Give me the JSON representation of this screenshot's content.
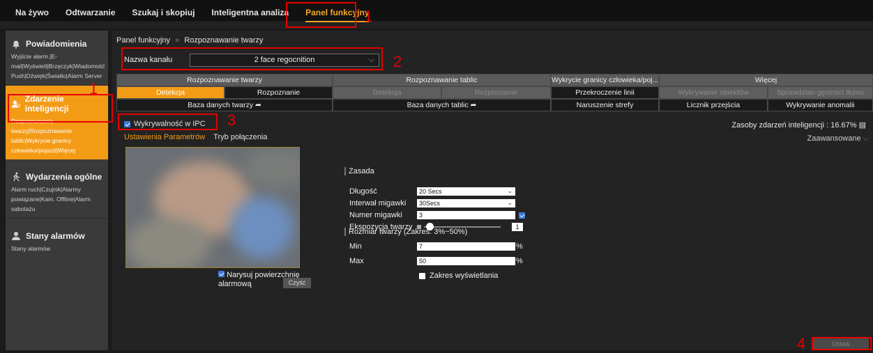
{
  "topnav": [
    {
      "label": "Na żywo",
      "active": false
    },
    {
      "label": "Odtwarzanie",
      "active": false
    },
    {
      "label": "Szukaj i skopiuj",
      "active": false
    },
    {
      "label": "Inteligentna analiza",
      "active": false
    },
    {
      "label": "Panel funkcyjny",
      "active": true
    }
  ],
  "sidebar": {
    "sections": [
      {
        "title": "Powiadomienia",
        "icon": "bell-icon",
        "links": "Wyjście alarm.|E-mail|Wyświetl|Brzęczyk|Wiadomość Push|Dźwięk|Światło|Alarm Server",
        "active": false
      },
      {
        "title": "Zdarzenie inteligencji",
        "icon": "face-scan-icon",
        "links": "Rozpoznawanie twarzy|Rozpoznawanie tablic|Wykrycie granicy człowieka/pojazd|Więcej",
        "active": true
      },
      {
        "title": "Wydarzenia ogólne",
        "icon": "motion-icon",
        "links": "Alarm ruch|Czujnik|Alarmy powiązane|Kam. Offline|Alarm sabotażu",
        "active": false
      },
      {
        "title": "Stany alarmów",
        "icon": "user-alarm-icon",
        "links": "Stany alarmów",
        "active": false
      }
    ]
  },
  "breadcrumb": {
    "root": "Panel funkcyjny",
    "sep": "»",
    "current": "Rozpoznawanie twarzy"
  },
  "channel": {
    "label": "Nazwa kanału",
    "value": "2 face regocnition"
  },
  "tabs": {
    "row1": [
      "Rozpoznawanie twarzy",
      "Rozpoznawanie tablic",
      "Wykrycie granicy człowieka/poj...",
      "Więcej"
    ],
    "row2": [
      "Detekcja",
      "Rozpoznanie",
      "Detekcja",
      "Rozpoznanie",
      "Przekroczenie linii",
      "Wykrywanie obiektów",
      "Sprawdzian gęstości tłumu"
    ],
    "row3": [
      "Baza danych twarzy ➦",
      "Baza danych tablic ➦",
      "Naruszenie strefy",
      "Licznik przejścia",
      "Wykrywanie anomalii"
    ]
  },
  "ipc": {
    "label": "Wykrywalność w IPC",
    "checked": true
  },
  "resource": "Zasoby zdarzeń inteligencji : 16.67%",
  "subtabs": [
    "Ustawienia Parametrów",
    "Tryb połączenia"
  ],
  "advanced": "Zaawansowane",
  "draw": {
    "label": "Narysuj powierzchnię alarmową",
    "checked": true,
    "clear": "Czyść"
  },
  "form": {
    "rule_title": "Zasada",
    "length_label": "Długość",
    "length_value": "20 Secs",
    "interval_label": "Interwał migawki",
    "interval_value": "30Secs",
    "snap_label": "Numer migawki",
    "snap_value": "3",
    "exposure_label": "Ekspozycja twarzy",
    "exposure_value": "1",
    "face_size_title": "Rozmiar twarzy (Zakres: 3%~50%)",
    "min_label": "Min",
    "min_value": "7",
    "max_label": "Max",
    "max_value": "50",
    "pct": "%",
    "display_range": "Zakres wyświetlania"
  },
  "set_button": "Ustaw",
  "annotations": [
    "1",
    "1",
    "2",
    "3",
    "4"
  ],
  "colors": {
    "accent": "#f49b16",
    "annotation": "#e60000",
    "checkbox": "#3b7be0"
  }
}
